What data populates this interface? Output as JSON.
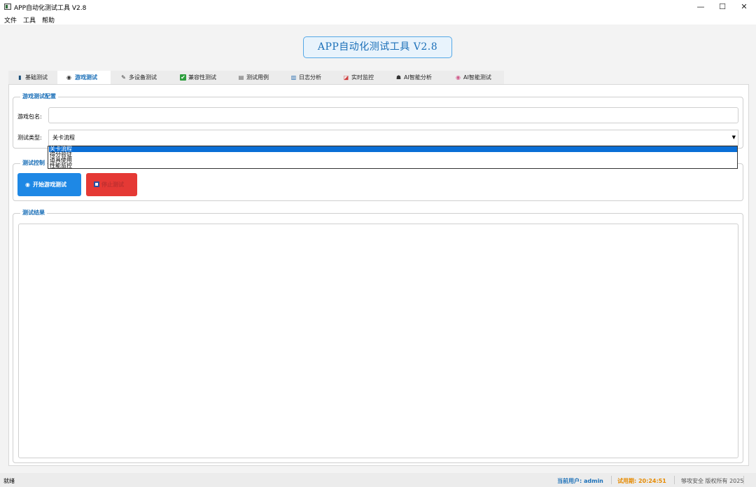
{
  "window": {
    "title": "APP自动化测试工具 V2.8",
    "minimize": "—",
    "maximize": "☐",
    "close": "✕"
  },
  "menu": [
    "文件",
    "工具",
    "帮助"
  ],
  "banner": "APP自动化测试工具 V2.8",
  "tabs": [
    {
      "label": "基础测试",
      "icon": "phone-icon",
      "glyph": "▮"
    },
    {
      "label": "游戏测试",
      "icon": "gamepad-icon",
      "glyph": "🎮"
    },
    {
      "label": "多设备测试",
      "icon": "pencil-icon",
      "glyph": "✎"
    },
    {
      "label": "兼容性测试",
      "icon": "check-icon",
      "glyph": "✔"
    },
    {
      "label": "测试用例",
      "icon": "clipboard-icon",
      "glyph": "▤"
    },
    {
      "label": "日志分析",
      "icon": "chart-icon",
      "glyph": "▥"
    },
    {
      "label": "实时监控",
      "icon": "trend-icon",
      "glyph": "◪"
    },
    {
      "label": "AI智能分析",
      "icon": "robot-icon",
      "glyph": "☗"
    },
    {
      "label": "AI智能测试",
      "icon": "brain-icon",
      "glyph": "◉"
    }
  ],
  "config": {
    "title": "游戏测试配置",
    "package_label": "游戏包名:",
    "package_value": "",
    "type_label": "测试类型:",
    "type_value": "关卡流程",
    "type_options": [
      "关卡流程",
      "得分验证",
      "道具使用",
      "性能监控"
    ]
  },
  "control": {
    "title": "测试控制",
    "start_label": "开始游戏测试",
    "start_icon": "gamepad-icon",
    "stop_label": "停止测试",
    "stop_icon": "stop-icon"
  },
  "results": {
    "title": "测试结果",
    "content": ""
  },
  "status": {
    "left": "就绪",
    "user": "当前用户: admin",
    "trial": "试用期: 20:24:51",
    "copyright": "够攻安全 版权所有 2025"
  },
  "colors": {
    "accent": "#1a6fb8",
    "start_button": "#1e88e5",
    "stop_button": "#e53935",
    "trial_text": "#e68a00",
    "selection": "#0a6ed6"
  }
}
